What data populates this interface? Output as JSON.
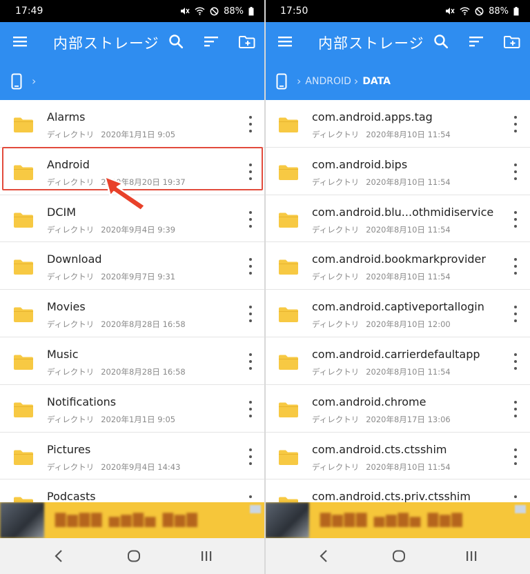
{
  "colors": {
    "appbar": "#2f8df0",
    "folder": "#f7c943",
    "highlight": "#e24a3b",
    "arrow": "#e8412a"
  },
  "left": {
    "status": {
      "time": "17:49",
      "battery": "88%"
    },
    "appbar": {
      "title": "内部ストレージ"
    },
    "path": {
      "crumbs": []
    },
    "files": [
      {
        "name": "Alarms",
        "type": "ディレクトリ",
        "date": "2020年1月1日 9:05"
      },
      {
        "name": "Android",
        "type": "ディレクトリ",
        "date": "2020年8月20日 19:37"
      },
      {
        "name": "DCIM",
        "type": "ディレクトリ",
        "date": "2020年9月4日 9:39"
      },
      {
        "name": "Download",
        "type": "ディレクトリ",
        "date": "2020年9月7日 9:31"
      },
      {
        "name": "Movies",
        "type": "ディレクトリ",
        "date": "2020年8月28日 16:58"
      },
      {
        "name": "Music",
        "type": "ディレクトリ",
        "date": "2020年8月28日 16:58"
      },
      {
        "name": "Notifications",
        "type": "ディレクトリ",
        "date": "2020年1月1日 9:05"
      },
      {
        "name": "Pictures",
        "type": "ディレクトリ",
        "date": "2020年9月4日 14:43"
      },
      {
        "name": "Podcasts",
        "type": "",
        "date": ""
      }
    ]
  },
  "right": {
    "status": {
      "time": "17:50",
      "battery": "88%"
    },
    "appbar": {
      "title": "内部ストレージ"
    },
    "path": {
      "crumbs": [
        "ANDROID",
        "DATA"
      ]
    },
    "files": [
      {
        "name": "com.android.apps.tag",
        "type": "ディレクトリ",
        "date": "2020年8月10日 11:54"
      },
      {
        "name": "com.android.bips",
        "type": "ディレクトリ",
        "date": "2020年8月10日 11:54"
      },
      {
        "name": "com.android.blu...othmidiservice",
        "type": "ディレクトリ",
        "date": "2020年8月10日 11:54"
      },
      {
        "name": "com.android.bookmarkprovider",
        "type": "ディレクトリ",
        "date": "2020年8月10日 11:54"
      },
      {
        "name": "com.android.captiveportallogin",
        "type": "ディレクトリ",
        "date": "2020年8月10日 12:00"
      },
      {
        "name": "com.android.carrierdefaultapp",
        "type": "ディレクトリ",
        "date": "2020年8月10日 11:54"
      },
      {
        "name": "com.android.chrome",
        "type": "ディレクトリ",
        "date": "2020年8月17日 13:06"
      },
      {
        "name": "com.android.cts.ctsshim",
        "type": "ディレクトリ",
        "date": "2020年8月10日 11:54"
      },
      {
        "name": "com.android.cts.priv.ctsshim",
        "type": "",
        "date": ""
      }
    ]
  },
  "icons": {
    "menu": "menu-icon",
    "search": "search-icon",
    "sort": "sort-icon",
    "new_folder": "create-new-folder-icon",
    "phone": "phone-storage-icon",
    "folder": "folder-icon",
    "more": "more-vertical-icon",
    "back": "back-icon",
    "home": "home-icon",
    "recents": "recent-apps-icon"
  }
}
